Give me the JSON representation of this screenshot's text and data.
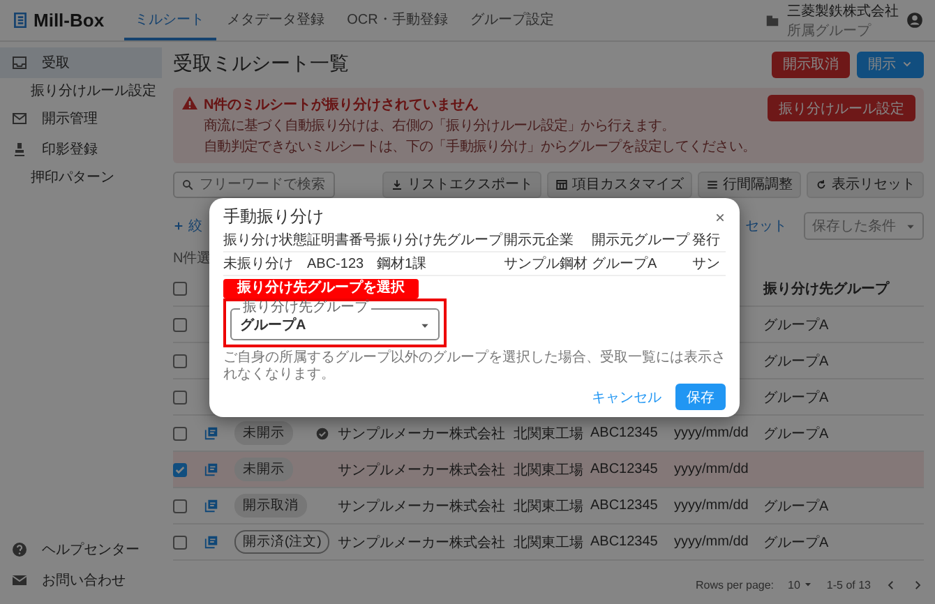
{
  "app": {
    "logo": "Mill-Box"
  },
  "nav_tabs": [
    {
      "label": "ミルシート",
      "selected": true
    },
    {
      "label": "メタデータ登録",
      "selected": false
    },
    {
      "label": "OCR・手動登録",
      "selected": false
    },
    {
      "label": "グループ設定",
      "selected": false
    }
  ],
  "account": {
    "company": "三菱製鉄株式会社",
    "group": "所属グループ"
  },
  "sidebar": {
    "items": [
      {
        "label": "受取",
        "selected": true,
        "children": [
          {
            "label": "振り分けルール設定",
            "selected": false
          }
        ]
      },
      {
        "label": "開示管理",
        "selected": false
      },
      {
        "label": "印影登録",
        "selected": false,
        "children": [
          {
            "label": "押印パターン",
            "selected": false
          }
        ]
      }
    ],
    "footer": [
      {
        "label": "ヘルプセンター"
      },
      {
        "label": "お問い合わせ"
      }
    ]
  },
  "page": {
    "title": "受取ミルシート一覧",
    "cancel_button": "開示取消",
    "disclose_button": "開示"
  },
  "alert": {
    "title": "N件のミルシートが振り分けされていません",
    "lines": [
      "商流に基づく自動振り分けは、右側の「振り分けルール設定」から行えます。",
      "自動判定できないミルシートは、下の「手動振り分け」からグループを設定してください。"
    ],
    "button": "振り分けルール設定"
  },
  "toolbar": {
    "search_placeholder": "フリーワードで検索",
    "buttons": [
      "リストエクスポート",
      "項目カスタマイズ",
      "行間隔調整",
      "表示リセット"
    ]
  },
  "filter": {
    "add_label": "絞",
    "reset_link": "セット",
    "saved_select": "保存した条件"
  },
  "selection_count": "N件選",
  "table": {
    "header_checked": false,
    "group_column": "振り分け先グループ",
    "rows": [
      {
        "checked": false,
        "group": "グループA"
      },
      {
        "checked": false,
        "group": "グループA"
      },
      {
        "checked": false,
        "group": "グループA"
      },
      {
        "checked": false,
        "status": "未開示",
        "status_outlined": false,
        "verified": true,
        "company": "サンプルメーカー株式会社",
        "factory": "北関東工場",
        "code": "ABC12345",
        "date": "yyyy/mm/dd",
        "group": "グループA"
      },
      {
        "checked": true,
        "status": "未開示",
        "status_outlined": false,
        "verified": false,
        "company": "サンプルメーカー株式会社",
        "factory": "北関東工場",
        "code": "ABC12345",
        "date": "yyyy/mm/dd"
      },
      {
        "checked": false,
        "status": "開示取消",
        "status_outlined": false,
        "verified": false,
        "company": "サンプルメーカー株式会社",
        "factory": "北関東工場",
        "code": "ABC12345",
        "date": "yyyy/mm/dd",
        "group": "グループA"
      },
      {
        "checked": false,
        "status": "開示済(注文)",
        "status_outlined": true,
        "verified": false,
        "company": "サンプルメーカー株式会社",
        "factory": "北関東工場",
        "code": "ABC12345",
        "date": "yyyy/mm/dd",
        "group": "グループA"
      }
    ]
  },
  "pagination": {
    "rows_per_page_label": "Rows per page:",
    "rows_per_page": "10",
    "range": "1-5 of 13"
  },
  "modal": {
    "title": "手動振り分け",
    "columns": [
      "振り分け状態",
      "証明書番号",
      "振り分け先グループ",
      "開示元企業",
      "開示元グループ",
      "発行"
    ],
    "row": [
      "未振り分け",
      "ABC-123",
      "鋼材1課",
      "サンプル鋼材",
      "グループA",
      "サン"
    ],
    "annotation": "振り分け先グループを選択",
    "select": {
      "label": "振り分け先グループ",
      "value": "グループA"
    },
    "helper": "ご自身の所属するグループ以外のグループを選択した場合、受取一覧には表示されなくなります。",
    "cancel": "キャンセル",
    "save": "保存"
  }
}
